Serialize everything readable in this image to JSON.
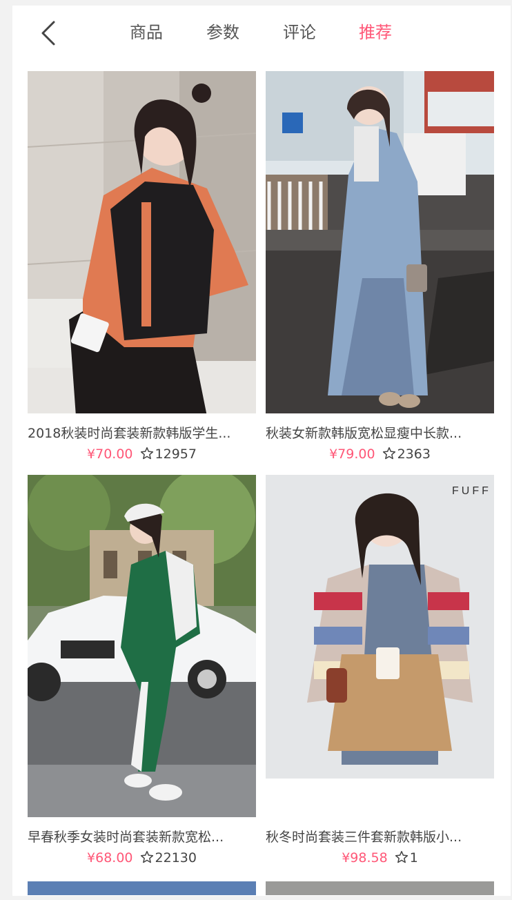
{
  "nav": {
    "tabs": [
      "商品",
      "参数",
      "评论",
      "推荐"
    ],
    "active_tab": "推荐"
  },
  "colors": {
    "accent": "#ff5777",
    "text": "#444444"
  },
  "products": [
    {
      "title": "2018秋装时尚套装新款韩版学生...",
      "price": "¥70.00",
      "favorites": "12957"
    },
    {
      "title": "秋装女新款韩版宽松显瘦中长款...",
      "price": "¥79.00",
      "favorites": "2363"
    },
    {
      "title": "早春秋季女装时尚套装新款宽松...",
      "price": "¥68.00",
      "favorites": "22130"
    },
    {
      "title": "秋冬时尚套装三件套新款韩版小...",
      "price": "¥98.58",
      "favorites": "1"
    }
  ],
  "icons": {
    "back": "chevron-left-icon",
    "favorite": "star-outline-icon"
  }
}
